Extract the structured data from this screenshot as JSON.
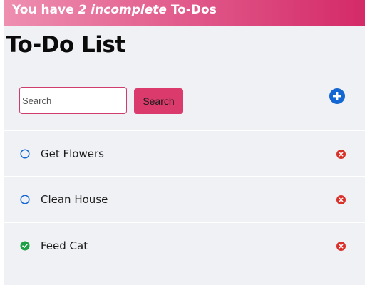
{
  "banner": {
    "prefix": "You have ",
    "count": "2 incomplete",
    "suffix": " To-Dos"
  },
  "page_title": "To-Do List",
  "search": {
    "placeholder": "Search",
    "value": "",
    "button_label": "Search"
  },
  "add_icon": "plus-circle-icon",
  "colors": {
    "banner_start": "#ee8fb0",
    "banner_end": "#d42a67",
    "accent_pink": "#db3b6c",
    "add_blue": "#1467d2",
    "incomplete_blue": "#1467d2",
    "complete_green": "#1e9e45",
    "delete_red": "#d9302a",
    "background": "#f0f1f5"
  },
  "todos": [
    {
      "label": "Get Flowers",
      "completed": false
    },
    {
      "label": "Clean House",
      "completed": false
    },
    {
      "label": "Feed Cat",
      "completed": true
    }
  ]
}
